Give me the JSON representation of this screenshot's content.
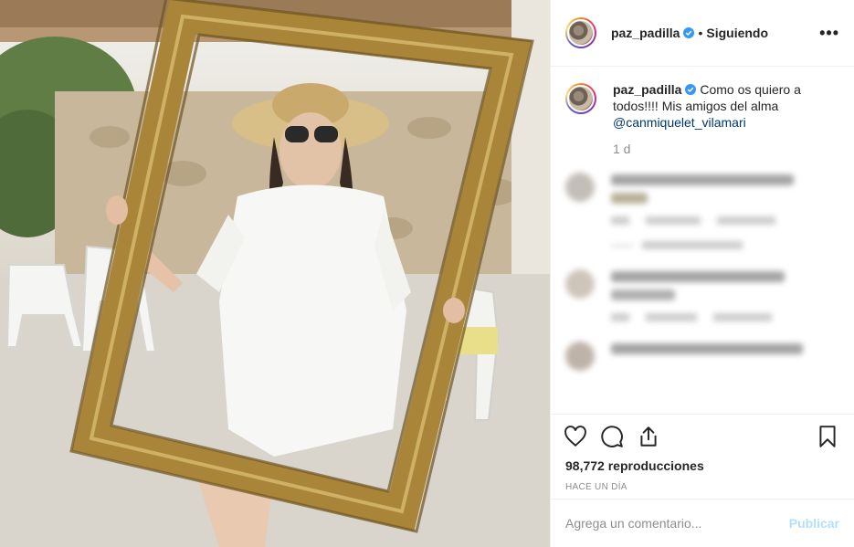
{
  "post": {
    "media_alt": "",
    "colors": {
      "frame": "#b08a3c",
      "link": "#00376b",
      "verified": "#3897f0",
      "publish": "#b2dffc"
    }
  },
  "header": {
    "username": "paz_padilla",
    "separator": "•",
    "follow_status": "Siguiendo",
    "more_label": "•••"
  },
  "caption": {
    "username": "paz_padilla",
    "text": "Como os quiero a todos!!!! Mis amigos del alma",
    "mention": "@canmiquelet_vilamari",
    "age": "1 d"
  },
  "actions": {
    "icons": [
      "heart-icon",
      "comment-icon",
      "share-icon",
      "bookmark-icon"
    ],
    "views": "98,772 reproducciones",
    "posted_ago": "HACE UN DÍA"
  },
  "add_comment": {
    "placeholder": "Agrega un comentario...",
    "publish_label": "Publicar"
  }
}
